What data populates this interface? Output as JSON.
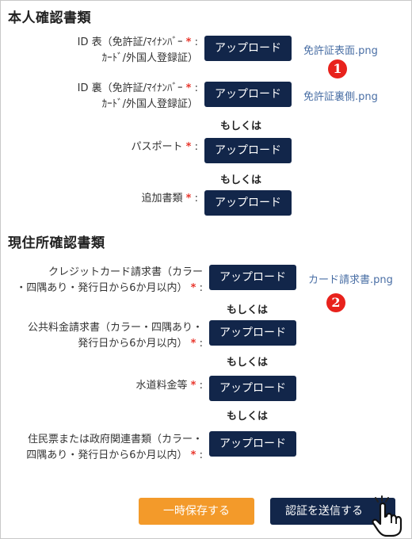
{
  "identity": {
    "title": "本人確認書類",
    "id_front_label_1": "ID 表（免許証/ﾏｲﾅﾝﾊﾞｰ",
    "id_front_label_2": "ｶｰﾄﾞ/外国人登録証）",
    "id_front_file": "免許証表面.png",
    "id_back_label_1": "ID 裏（免許証/ﾏｲﾅﾝﾊﾞｰ",
    "id_back_label_2": "ｶｰﾄﾞ/外国人登録証）",
    "id_back_file": "免許証裏側.png",
    "passport_label": "パスポート",
    "additional_label": "追加書類"
  },
  "address": {
    "title": "現住所確認書類",
    "credit_label_1": "クレジットカード請求書（カラー",
    "credit_label_2": "・四隅あり・発行日から6か月以内）",
    "credit_file": "カード請求書.png",
    "utility_label_1": "公共料金請求書（カラー・四隅あり・",
    "utility_label_2": "発行日から6か月以内）",
    "water_label": "水道料金等",
    "resident_label_1": "住民票または政府関連書類（カラー・",
    "resident_label_2": "四隅あり・発行日から6か月以内）"
  },
  "common": {
    "upload_label": "アップロード",
    "or_label": "もしくは",
    "required_mark": "*",
    "colon": ":"
  },
  "badges": {
    "one": "1",
    "two": "2"
  },
  "footer": {
    "save_label": "一時保存する",
    "submit_label": "認証を送信する"
  },
  "colors": {
    "navy": "#12264a",
    "orange": "#f39a2a",
    "required": "#e8352b",
    "link": "#4a6fa5",
    "badge": "#e8221c"
  }
}
